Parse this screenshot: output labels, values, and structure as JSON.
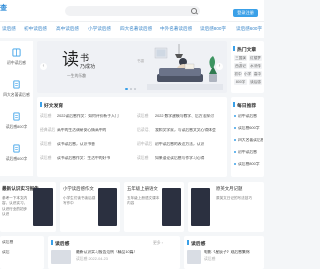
{
  "header": {
    "logo": "查",
    "search_placeholder": "",
    "login_label": "登录注册"
  },
  "nav": {
    "items": [
      "读后感",
      "初中读后感",
      "高中读后感",
      "小学读后感",
      "四大名著读后感",
      "中外名著读后感",
      "读后感800字",
      "读后感600字"
    ]
  },
  "sidebar": {
    "items": [
      {
        "label": "初中读后感",
        "icon": "book-icon"
      },
      {
        "label": "四大名著读后感",
        "icon": "document-icon"
      },
      {
        "label": "读后感800字",
        "icon": "document-icon"
      },
      {
        "label": "读后感600字",
        "icon": "document-icon"
      }
    ]
  },
  "banner": {
    "big_char": "读",
    "small_char": "书",
    "subtitle": "乃成功",
    "caption": "一生的乐趣",
    "tiny": "书香",
    "prev": "‹",
    "next": "›"
  },
  "hot_tags": {
    "title": "热门文章",
    "tags": [
      "三国演义",
      "红楼梦",
      "西游记",
      "水浒传",
      "初中",
      "小学",
      "高中",
      "800字",
      "读后感"
    ]
  },
  "recommend": {
    "title": "好文发育",
    "rows": [
      {
        "col1": "读后感",
        "text1": "2022读后感作文：如何评价新手入门",
        "col2": "读后感",
        "text2": "2022 数学建模与教学、后方法探讨"
      },
      {
        "col1": "经典读后",
        "text1": "高中的生活调研安心情高中的",
        "col2": "后读话、",
        "text2": "我和文学家，写读后感文文心得体会"
      },
      {
        "col1": "读后感",
        "text1": "读书读后感，认识书香",
        "col2": "初中读后",
        "text2": "初中读后感的表达方法，认识"
      },
      {
        "col1": "读后感",
        "text1": "读书读后感作文：生活中的好书",
        "col2": "读后感",
        "text2": "如果谈论读后感写作学习心得"
      }
    ]
  },
  "daily": {
    "title": "每日推荐",
    "rows": [
      "初中读后感",
      "读后感600字",
      "四大名著读后感",
      "初中读后感",
      "读后感800字"
    ]
  },
  "mid_row": {
    "left_title": "最新认识实习报告",
    "left_text": "参考一下本文内容，认识实习，认识行业的初步认识",
    "cards": [
      {
        "title": "小学读后感作文",
        "text": "小学生们读书读后感写作中"
      },
      {
        "title": "五年级上册语文",
        "text": "五年级上册语文课本内容"
      },
      {
        "title": "原英文月记题",
        "text": "原英文日记的写法技巧"
      }
    ]
  },
  "bottom_left": {
    "title": "读后感",
    "more": "更多 ›",
    "rows": [
      {
        "title": "最新认识实习报告范例（精品10篇）",
        "date": "读后感 2022-04-23"
      },
      {
        "title": "最新认识实习报告，认识实习",
        "date": "读后感 2022-04-22"
      }
    ],
    "side": [
      "读后感",
      "读后"
    ]
  },
  "bottom_right": {
    "title": "读后感",
    "rows": [
      {
        "title": "电影《星辰子》观后感集锦",
        "date": "读后感"
      },
      {
        "title": "最新认识实习报告",
        "date": "读后感"
      }
    ]
  },
  "colors": {
    "accent": "#3aa0e8",
    "link": "#3a86c9"
  }
}
